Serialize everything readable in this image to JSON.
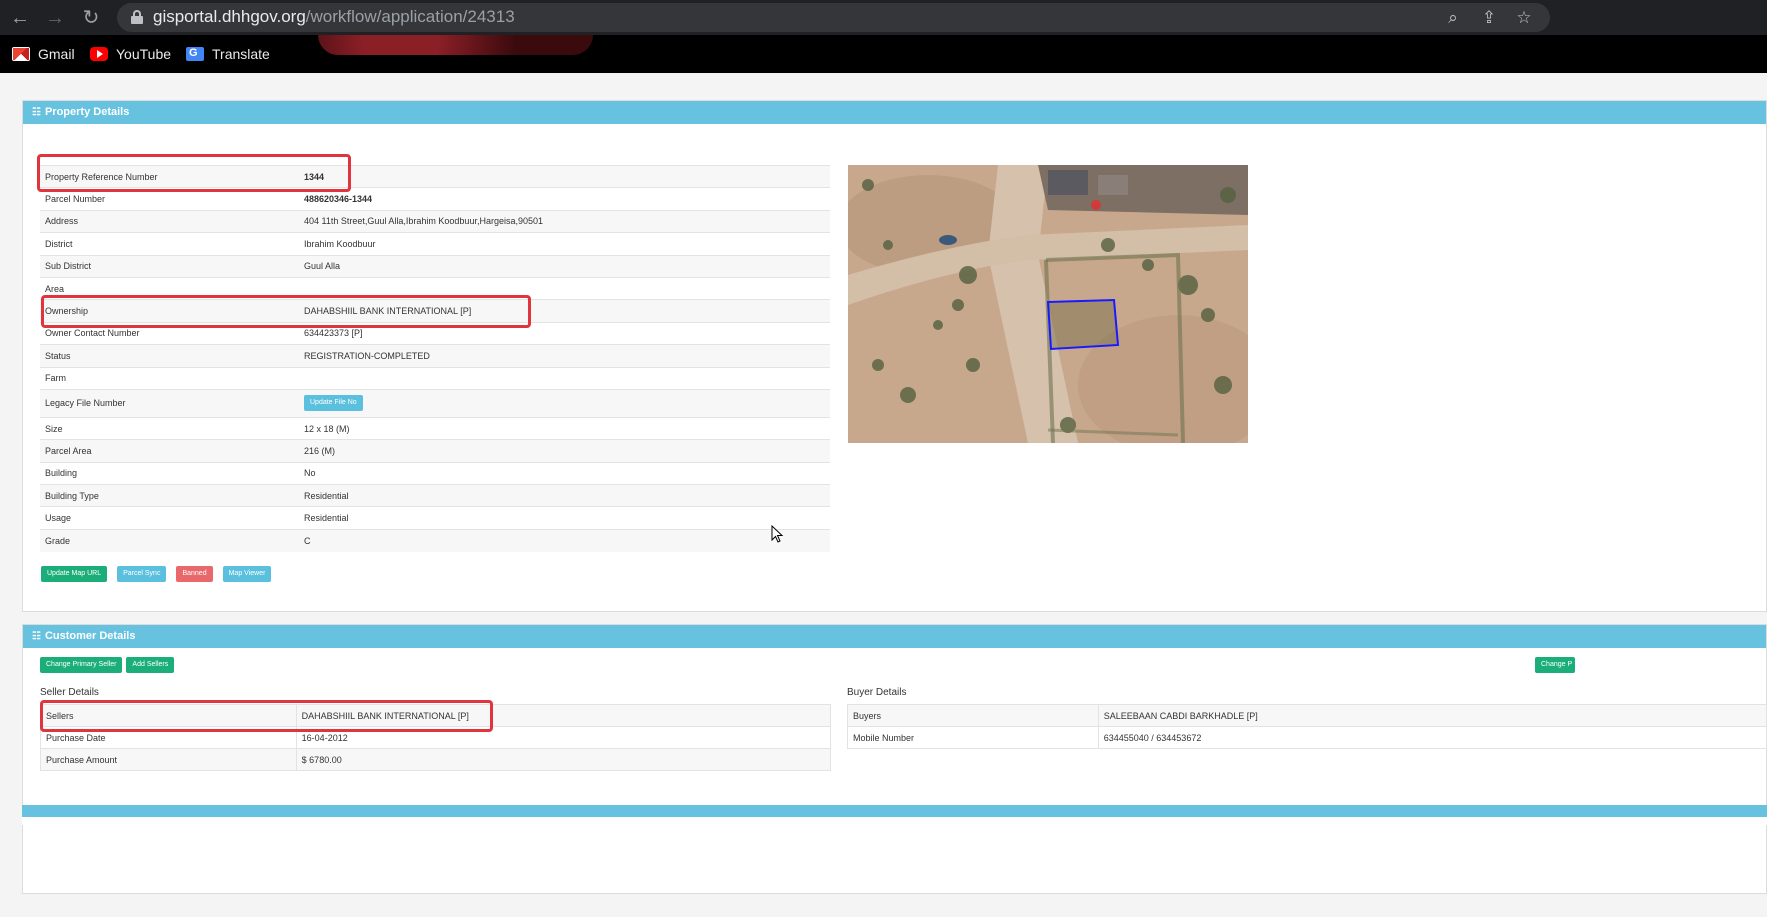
{
  "browser": {
    "url_host": "gisportal.dhhgov.org",
    "url_path": "/workflow/application/24313",
    "bookmarks": [
      {
        "label": "Gmail",
        "icon": "gmail-icon"
      },
      {
        "label": "YouTube",
        "icon": "youtube-icon"
      },
      {
        "label": "Translate",
        "icon": "translate-icon"
      }
    ]
  },
  "property": {
    "title": "Property Details",
    "rows": [
      {
        "label": "Property Reference Number",
        "value": "1344"
      },
      {
        "label": "Parcel Number",
        "value": "488620346-1344"
      },
      {
        "label": "Address",
        "value": "404 11th Street,Guul Alla,Ibrahim Koodbuur,Hargeisa,90501"
      },
      {
        "label": "District",
        "value": "Ibrahim Koodbuur"
      },
      {
        "label": "Sub District",
        "value": "Guul Alla"
      },
      {
        "label": "Area",
        "value": ""
      },
      {
        "label": "Ownership",
        "value": "DAHABSHIIL BANK INTERNATIONAL [P]"
      },
      {
        "label": "Owner Contact Number",
        "value": "634423373 [P]"
      },
      {
        "label": "Status",
        "value": "REGISTRATION-COMPLETED"
      },
      {
        "label": "Farm",
        "value": ""
      },
      {
        "label": "Legacy File Number",
        "value": "",
        "button": "Update File No"
      },
      {
        "label": "Size",
        "value": "12 x 18 (M)"
      },
      {
        "label": "Parcel Area",
        "value": "216 (M)"
      },
      {
        "label": "Building",
        "value": "No"
      },
      {
        "label": "Building Type",
        "value": "Residential"
      },
      {
        "label": "Usage",
        "value": "Residential"
      },
      {
        "label": "Grade",
        "value": "C"
      }
    ],
    "actions": [
      "Update Map URL",
      "Parcel Sync",
      "Banned",
      "Map Viewer"
    ]
  },
  "customer": {
    "title": "Customer Details",
    "actions": [
      "Change Primary Seller",
      "Add Sellers"
    ],
    "right_action": "Change P",
    "seller_heading": "Seller Details",
    "sellers": [
      {
        "label": "Sellers",
        "value": "DAHABSHIIL BANK INTERNATIONAL [P]"
      },
      {
        "label": "Purchase Date",
        "value": "16-04-2012"
      },
      {
        "label": "Purchase Amount",
        "value": "$ 6780.00"
      }
    ],
    "buyer_heading": "Buyer Details",
    "buyers": [
      {
        "label": "Buyers",
        "value": "SALEEBAAN CABDI BARKHADLE [P]"
      },
      {
        "label": "Mobile Number",
        "value": "634455040 / 634453672"
      }
    ]
  },
  "colors": {
    "panel_header": "#67c2e0",
    "highlight": "#e0343f",
    "btn_green": "#1cae7a",
    "btn_blue": "#5bc0de",
    "btn_red": "#e9686b"
  }
}
